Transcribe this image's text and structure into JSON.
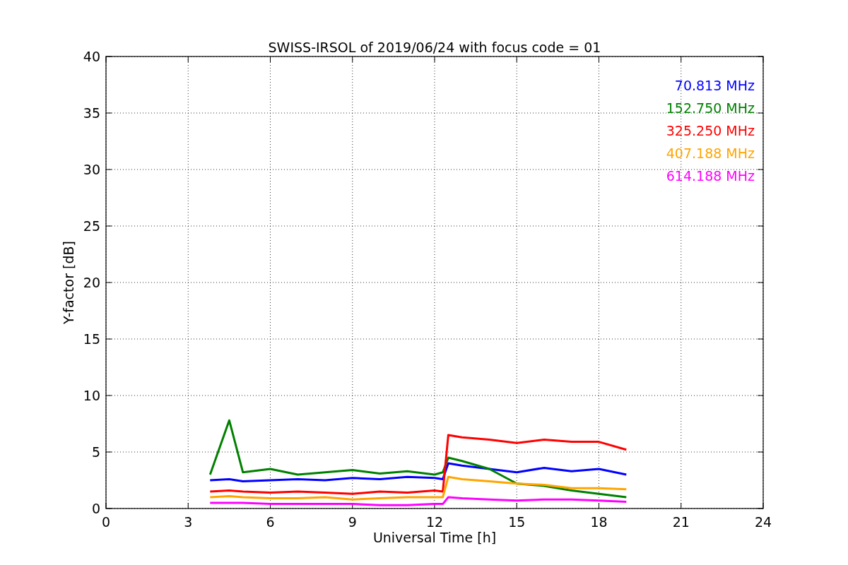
{
  "figure": {
    "chart_data": {
      "type": "line",
      "title": "SWISS-IRSOL of 2019/06/24 with focus code = 01",
      "xlabel": "Universal Time [h]",
      "ylabel": "Y-factor [dB]",
      "x": [
        3.8,
        4.5,
        5,
        6,
        7,
        8,
        9,
        10,
        11,
        12,
        12.3,
        12.5,
        13,
        14,
        15,
        16,
        17,
        18,
        19
      ],
      "series": [
        {
          "name": "70.813 MHz",
          "color": "#0000ff",
          "values": [
            2.5,
            2.6,
            2.4,
            2.5,
            2.6,
            2.5,
            2.7,
            2.6,
            2.8,
            2.7,
            2.6,
            4,
            3.8,
            3.5,
            3.2,
            3.6,
            3.3,
            3.5,
            3
          ]
        },
        {
          "name": "152.750 MHz",
          "color": "#008000",
          "values": [
            3,
            7.8,
            3.2,
            3.5,
            3,
            3.2,
            3.4,
            3.1,
            3.3,
            3,
            3.2,
            4.5,
            4.2,
            3.5,
            2.2,
            2,
            1.6,
            1.3,
            1
          ]
        },
        {
          "name": "325.250 MHz",
          "color": "#ff0000",
          "values": [
            1.5,
            1.6,
            1.5,
            1.4,
            1.5,
            1.4,
            1.3,
            1.5,
            1.4,
            1.6,
            1.5,
            6.5,
            6.3,
            6.1,
            5.8,
            6.1,
            5.9,
            5.9,
            5.2
          ]
        },
        {
          "name": "407.188 MHz",
          "color": "#ffa500",
          "values": [
            1,
            1.1,
            1,
            0.9,
            0.9,
            1,
            0.8,
            0.9,
            1,
            1,
            1,
            2.8,
            2.6,
            2.4,
            2.2,
            2.1,
            1.8,
            1.8,
            1.7
          ]
        },
        {
          "name": "614.188 MHz",
          "color": "#ff00ff",
          "values": [
            0.5,
            0.5,
            0.5,
            0.4,
            0.4,
            0.4,
            0.4,
            0.3,
            0.3,
            0.4,
            0.4,
            1,
            0.9,
            0.8,
            0.7,
            0.8,
            0.8,
            0.7,
            0.6
          ]
        }
      ],
      "xlim": [
        0,
        24
      ],
      "ylim": [
        0,
        40
      ],
      "xticks": [
        0,
        3,
        6,
        9,
        12,
        15,
        18,
        21,
        24
      ],
      "yticks": [
        0,
        5,
        10,
        15,
        20,
        25,
        30,
        35,
        40
      ],
      "grid": true
    }
  }
}
